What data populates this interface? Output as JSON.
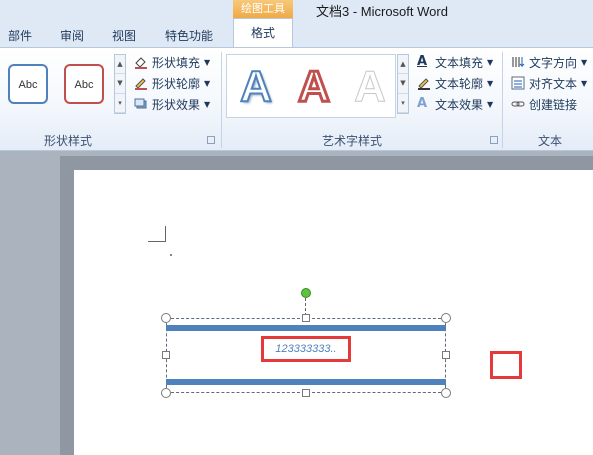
{
  "window": {
    "context_tab_header": "绘图工具",
    "title": "文档3  -  Microsoft Word"
  },
  "tabs": [
    {
      "label": "部件"
    },
    {
      "label": "审阅"
    },
    {
      "label": "视图"
    },
    {
      "label": "特色功能"
    }
  ],
  "active_tab": {
    "label": "格式"
  },
  "ribbon": {
    "shape_styles": {
      "label": "形状样式",
      "style_1": "Abc",
      "style_2": "Abc",
      "fill": "形状填充",
      "outline": "形状轮廓",
      "effects": "形状效果"
    },
    "wordart_styles": {
      "label": "艺术字样式",
      "sample_1": "A",
      "sample_2": "A",
      "sample_3": "A",
      "text_fill": "文本填充",
      "text_outline": "文本轮廓",
      "text_effects": "文本效果"
    },
    "text": {
      "label": "文本",
      "direction": "文字方向",
      "align": "对齐文本",
      "link": "创建链接"
    }
  },
  "document": {
    "textbox_text": "123333333.."
  },
  "colors": {
    "accent_blue": "#4f81bd",
    "highlight_red": "#e53a3a",
    "rotate_green": "#5ec23c"
  }
}
